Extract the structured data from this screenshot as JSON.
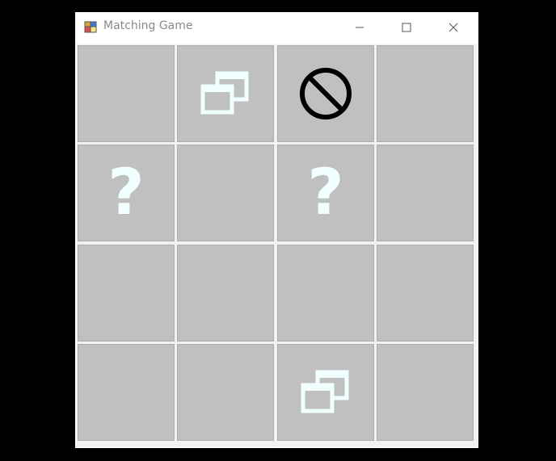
{
  "window": {
    "title": "Matching Game",
    "app_icon": "app-icon",
    "controls": [
      "minimize-icon",
      "maximize-icon",
      "close-icon"
    ]
  },
  "board": {
    "rows": 4,
    "cols": 4,
    "cells": [
      {
        "row": 0,
        "col": 0,
        "icon": ""
      },
      {
        "row": 0,
        "col": 1,
        "icon": "windows-icon"
      },
      {
        "row": 0,
        "col": 2,
        "icon": "no-entry-icon"
      },
      {
        "row": 0,
        "col": 3,
        "icon": ""
      },
      {
        "row": 1,
        "col": 0,
        "icon": "question-mark-icon",
        "text": "?"
      },
      {
        "row": 1,
        "col": 1,
        "icon": ""
      },
      {
        "row": 1,
        "col": 2,
        "icon": "question-mark-icon",
        "text": "?"
      },
      {
        "row": 1,
        "col": 3,
        "icon": ""
      },
      {
        "row": 2,
        "col": 0,
        "icon": ""
      },
      {
        "row": 2,
        "col": 1,
        "icon": ""
      },
      {
        "row": 2,
        "col": 2,
        "icon": ""
      },
      {
        "row": 2,
        "col": 3,
        "icon": ""
      },
      {
        "row": 3,
        "col": 0,
        "icon": ""
      },
      {
        "row": 3,
        "col": 1,
        "icon": ""
      },
      {
        "row": 3,
        "col": 2,
        "icon": "windows-icon"
      },
      {
        "row": 3,
        "col": 3,
        "icon": ""
      }
    ]
  },
  "colors": {
    "tile": "#c0c0c0",
    "icon_fill": "#f2ffff",
    "no_entry": "#000000"
  }
}
